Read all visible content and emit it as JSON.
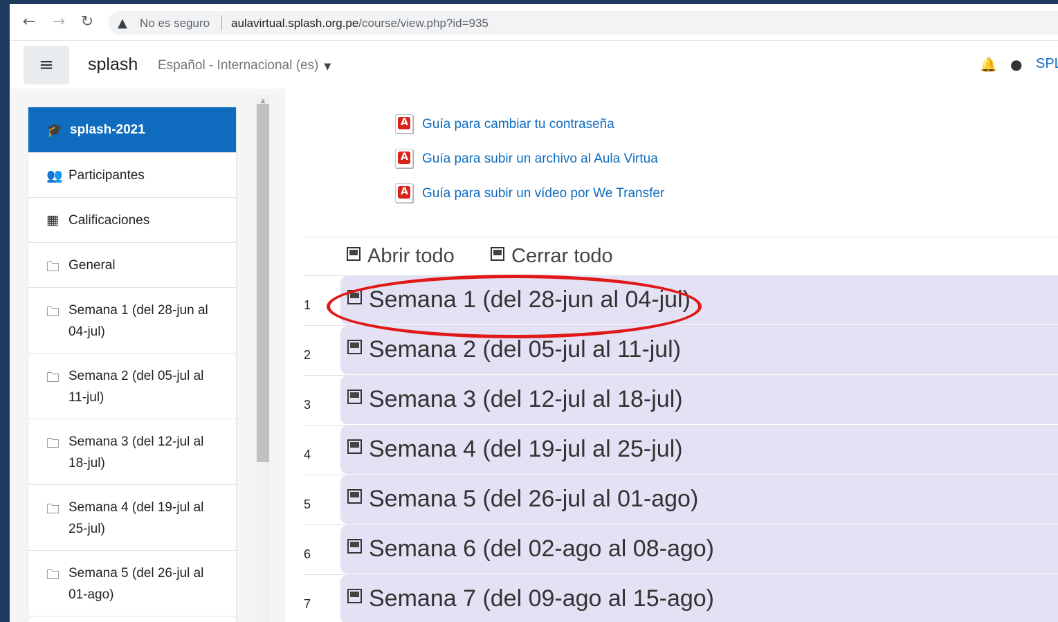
{
  "browser": {
    "back_icon": "arrow-left-icon",
    "forward_icon": "arrow-right-icon",
    "reload_icon": "reload-icon",
    "security_warning": "No es seguro",
    "url_host": "aulavirtual.splash.org.pe",
    "url_path": "/course/view.php?id=935"
  },
  "navbar": {
    "brand": "splash",
    "language": "Español - Internacional (es)",
    "user_short": "SPL"
  },
  "drawer": {
    "items": [
      {
        "label": "splash-2021",
        "icon": "graduation-cap-icon",
        "active": true
      },
      {
        "label": "Participantes",
        "icon": "users-icon"
      },
      {
        "label": "Calificaciones",
        "icon": "table-icon"
      },
      {
        "label": "General",
        "icon": "folder-icon"
      },
      {
        "label": "Semana 1 (del 28-jun al 04-jul)",
        "icon": "folder-icon"
      },
      {
        "label": "Semana 2 (del 05-jul al 11-jul)",
        "icon": "folder-icon"
      },
      {
        "label": "Semana 3 (del 12-jul al 18-jul)",
        "icon": "folder-icon"
      },
      {
        "label": "Semana 4 (del 19-jul al 25-jul)",
        "icon": "folder-icon"
      },
      {
        "label": "Semana 5 (del 26-jul al 01-ago)",
        "icon": "folder-icon"
      }
    ]
  },
  "resources": [
    {
      "label": "Guía para cambiar tu contraseña",
      "icon": "pdf-icon"
    },
    {
      "label": "Guía para subir un archivo al Aula Virtua",
      "icon": "pdf-icon"
    },
    {
      "label": "Guía para subir un vídeo por We Transfer",
      "icon": "pdf-icon"
    }
  ],
  "controls": {
    "open_all": "Abrir todo",
    "close_all": "Cerrar todo"
  },
  "sections": [
    {
      "num": "1",
      "title": "Semana 1 (del 28-jun al 04-jul)"
    },
    {
      "num": "2",
      "title": "Semana 2 (del 05-jul al 11-jul)"
    },
    {
      "num": "3",
      "title": "Semana 3 (del 12-jul al 18-jul)"
    },
    {
      "num": "4",
      "title": "Semana 4 (del 19-jul al 25-jul)"
    },
    {
      "num": "5",
      "title": "Semana 5 (del 26-jul al 01-ago)"
    },
    {
      "num": "6",
      "title": "Semana 6 (del 02-ago al 08-ago)"
    },
    {
      "num": "7",
      "title": "Semana 7 (del 09-ago al 15-ago)"
    }
  ],
  "colors": {
    "accent": "#0f6cbf",
    "section_bg": "#e3e1f3",
    "annotation": "#e01818"
  }
}
